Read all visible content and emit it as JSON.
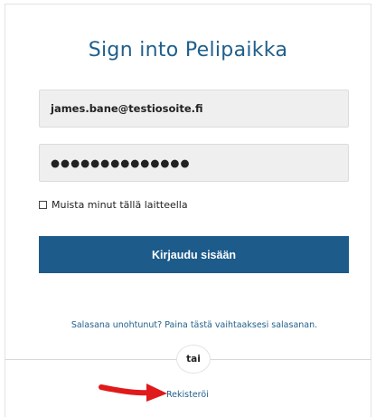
{
  "login": {
    "title": "Sign into Pelipaikka",
    "email_value": "james.bane@testiosoite.fi",
    "password_value": "●●●●●●●●●●●●●●",
    "remember_label": "Muista minut tällä laitteella",
    "submit_label": "Kirjaudu sisään",
    "forgot_text": "Salasana unohtunut? Paina tästä vaihtaaksesi salasanan.",
    "or_text": "tai",
    "register_label": "Rekisteröi"
  },
  "colors": {
    "accent": "#1c5b8a",
    "annotation_arrow": "#e0191b"
  },
  "icons": {
    "annotation": "red-arrow-icon"
  }
}
